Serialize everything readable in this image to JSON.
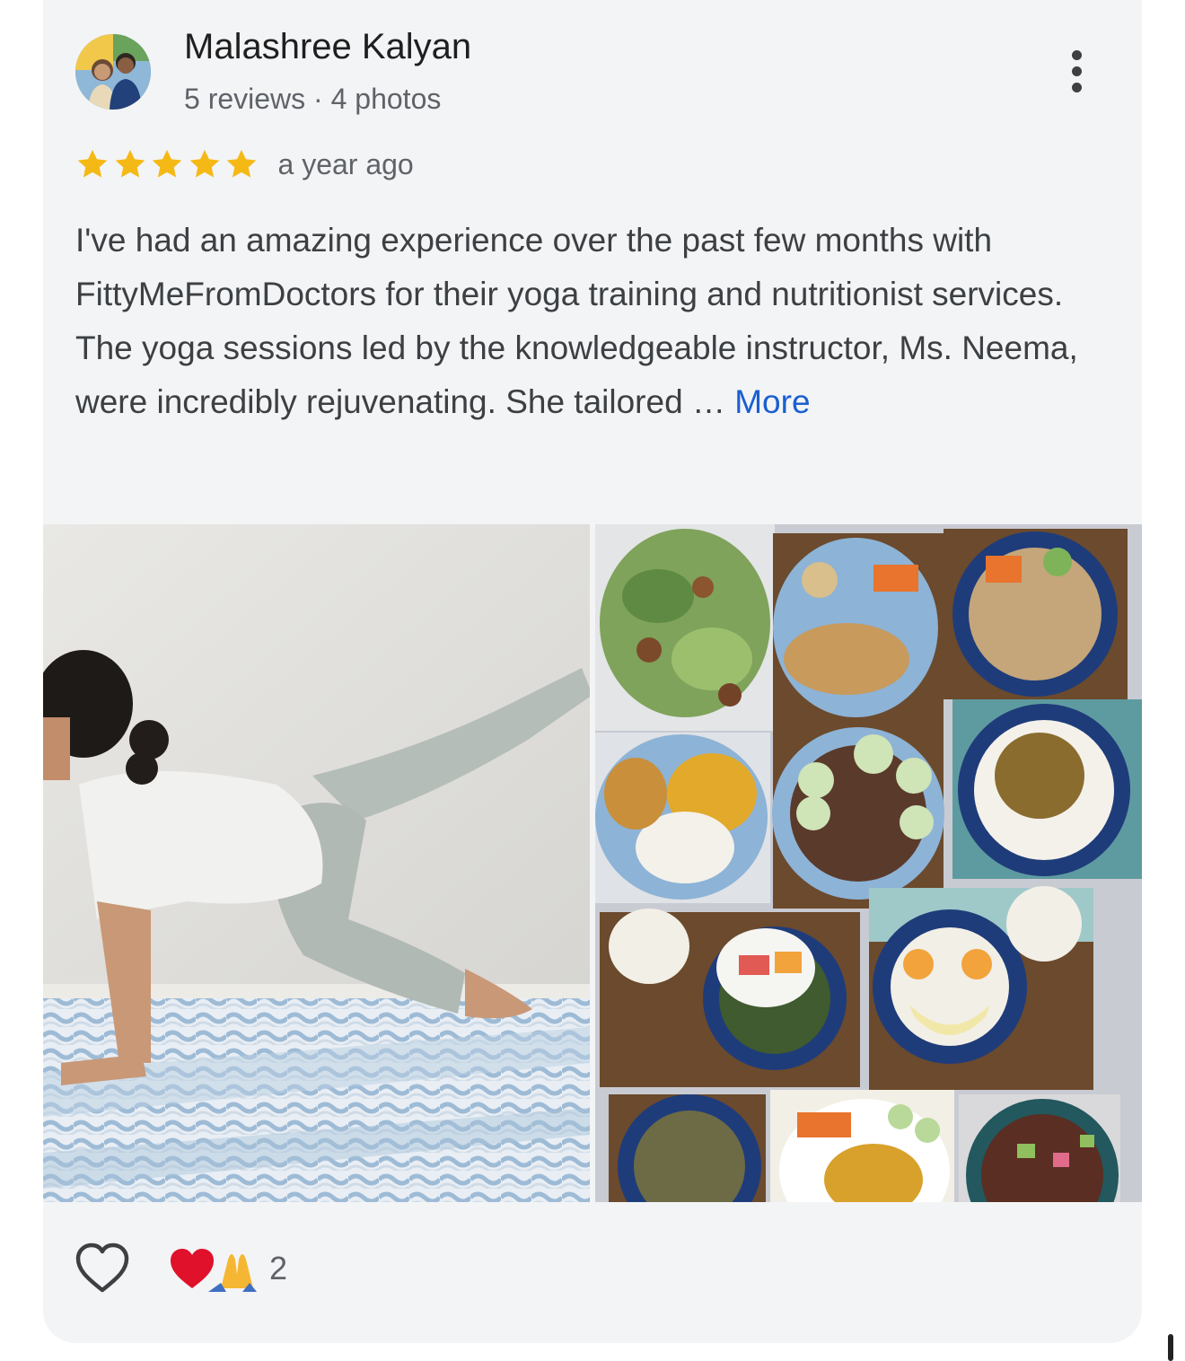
{
  "review": {
    "author": {
      "name": "Malashree Kalyan",
      "meta": "5 reviews · 4 photos"
    },
    "rating": 5,
    "rating_max": 5,
    "time_ago": "a year ago",
    "text": "I've had an amazing experience over the past few months with FittyMeFromDoctors for their yoga training and nutritionist services. The yoga sessions led by the knowledgeable instructor, Ms. Neema, were incredibly rejuvenating. She tailored …",
    "more_label": "More",
    "reactions": {
      "emojis": "❤️🙏",
      "count": "2"
    }
  },
  "colors": {
    "card_background": "#f3f4f6",
    "star": "#f5b916",
    "link": "#1a5fd0",
    "secondary_text": "#5f6368"
  },
  "icons": {
    "more": "more-vertical-icon",
    "star": "star-icon",
    "like": "heart-outline-icon"
  }
}
